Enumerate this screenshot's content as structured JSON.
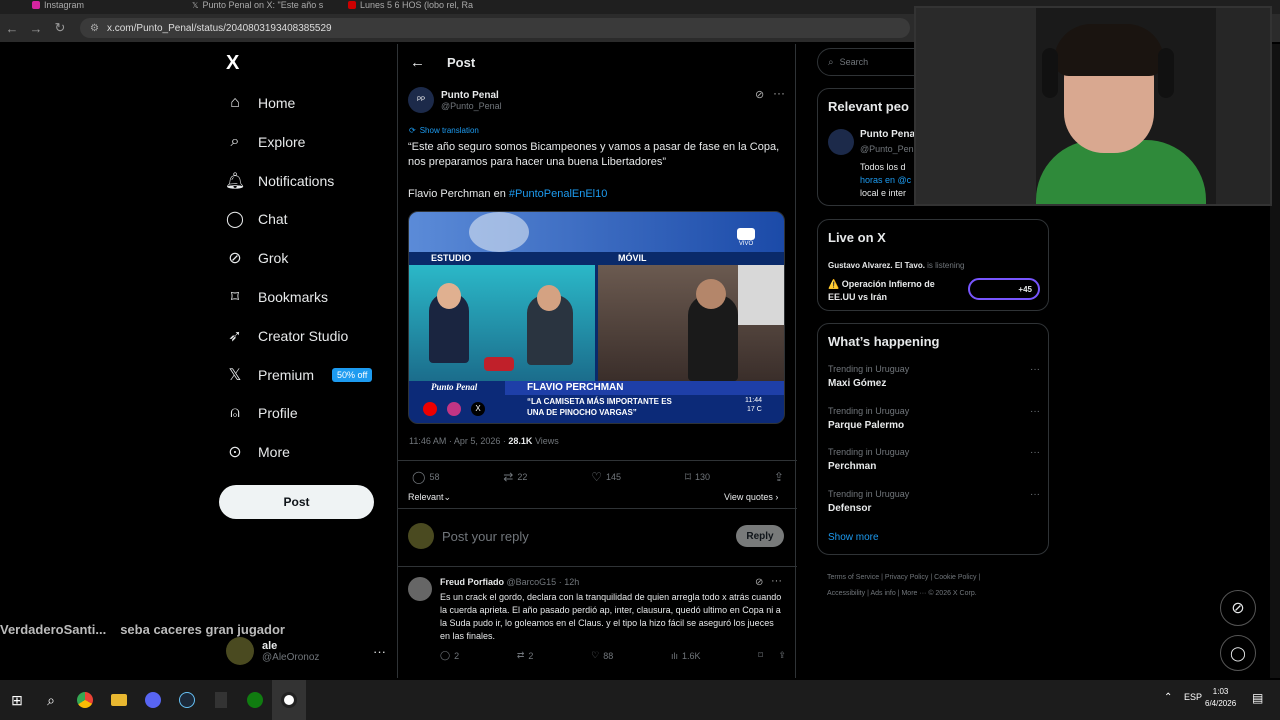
{
  "browser": {
    "tabs": [
      {
        "label": "Instagram"
      },
      {
        "label": "Punto Penal on X: \"Este año s"
      },
      {
        "label": "Lunes 5 6 HOS (lobo rel, Ra"
      }
    ],
    "url": "x.com/Punto_Penal/status/2040803193408385529"
  },
  "nav": {
    "logo": "X",
    "items": [
      {
        "label": "Home",
        "icon": "home-icon"
      },
      {
        "label": "Explore",
        "icon": "search-icon"
      },
      {
        "label": "Notifications",
        "icon": "bell-icon"
      },
      {
        "label": "Chat",
        "icon": "chat-icon"
      },
      {
        "label": "Grok",
        "icon": "grok-icon"
      },
      {
        "label": "Bookmarks",
        "icon": "bookmark-icon"
      },
      {
        "label": "Creator Studio",
        "icon": "rocket-icon"
      },
      {
        "label": "Premium",
        "icon": "x-icon"
      },
      {
        "label": "Profile",
        "icon": "person-icon"
      },
      {
        "label": "More",
        "icon": "more-circle-icon"
      }
    ],
    "premium_badge": "50% off",
    "post_label": "Post",
    "account_name": "ale",
    "account_handle": "@AleOronoz"
  },
  "overlay_text": [
    "VerdaderoSanti...",
    "seba caceres gran jugador"
  ],
  "post": {
    "header_title": "Post",
    "author_name": "Punto Penal",
    "author_handle": "@Punto_Penal",
    "show_translation": "Show translation",
    "text": "“Este año seguro somos Bicampeones y vamos a pasar de fase en la Copa, nos preparamos para hacer una buena Libertadores”",
    "text2_prefix": "Flavio Perchman en ",
    "hashtag": "#PuntoPenalEnEl10",
    "media": {
      "studio_label": "ESTUDIO",
      "mobile_label": "MÓVIL",
      "live_label": "VIVO",
      "brand": "Punto Penal",
      "name_bar": "FLAVIO PERCHMAN",
      "quote_line1": "“LA CAMISETA MÁS IMPORTANTE ES",
      "quote_line2": "UNA DE PINOCHO VARGAS”",
      "clock": "11:44",
      "temp": "17 C"
    },
    "timestamp": "11:46 AM · Apr 5, 2026 · ",
    "views_count": "28.1K",
    "views_label": " Views",
    "replies": "58",
    "reposts": "22",
    "likes": "145",
    "bookmarks": "130",
    "relevant_label": "Relevant",
    "view_quotes": "View quotes",
    "reply_placeholder": "Post your reply",
    "reply_button": "Reply"
  },
  "reply": {
    "name": "Freud Porfiado",
    "handle": "@BarcoG15",
    "time": "· 12h",
    "text": "Es un crack el gordo, declara con la tranquilidad de quien arregla todo x atrás cuando la cuerda aprieta. El año pasado perdió ap, inter, clausura, quedó ultimo en Copa ni a la Suda pudo ir, lo goleamos en el Claus. y el tipo la hizo fácil se aseguró los jueces en las finales.",
    "replies": "2",
    "reposts": "2",
    "likes": "88",
    "views": "1.6K"
  },
  "right": {
    "search_placeholder": "Search",
    "relevant_title": "Relevant peo",
    "relevant_name": "Punto Penal",
    "relevant_handle": "@Punto_Penal",
    "relevant_bio1": "Todos los d",
    "relevant_bio2": "horas en @c",
    "relevant_bio3": "local e inter",
    "live_title": "Live on X",
    "live_host": "Gustavo Alvarez. El Tavo.",
    "live_status": " is listening",
    "live_topic1": "⚠️ Operación Infierno de",
    "live_topic2": "EE.UU vs Irán",
    "live_count": "+45",
    "happening_title": "What’s happening",
    "trends": [
      {
        "context": "Trending in Uruguay",
        "name": "Maxi Gómez"
      },
      {
        "context": "Trending in Uruguay",
        "name": "Parque Palermo"
      },
      {
        "context": "Trending in Uruguay",
        "name": "Perchman"
      },
      {
        "context": "Trending in Uruguay",
        "name": "Defensor"
      }
    ],
    "show_more": "Show more",
    "footer": [
      "Terms of Service",
      "Privacy Policy",
      "Cookie Policy",
      "Accessibility",
      "Ads info",
      "More ···",
      "© 2026 X Corp."
    ]
  },
  "taskbar": {
    "lang": "ESP",
    "time": "1:03",
    "date": "6/4/2026"
  },
  "colors": {
    "accent": "#1d9bf0",
    "background": "#000000",
    "border": "#2f3336",
    "muted": "#71767b"
  }
}
